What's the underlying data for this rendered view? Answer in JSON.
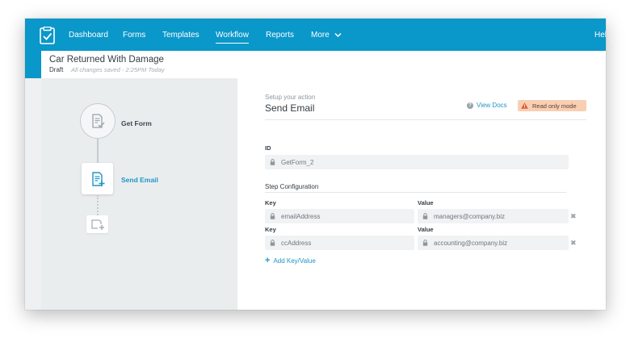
{
  "nav": {
    "items": [
      {
        "label": "Dashboard",
        "active": false
      },
      {
        "label": "Forms",
        "active": false
      },
      {
        "label": "Templates",
        "active": false
      },
      {
        "label": "Workflow",
        "active": true
      },
      {
        "label": "Reports",
        "active": false
      },
      {
        "label": "More",
        "active": false
      }
    ],
    "user_label": "Hel",
    "icons": {
      "logo": "clipboard-check-icon",
      "more": "chevron-down-icon"
    }
  },
  "document": {
    "title": "Car Returned With Damage",
    "status": "Draft",
    "saved_text": "All changes saved - 2:25PM Today"
  },
  "workflow": {
    "steps": [
      {
        "label": "Get Form",
        "icon": "document-check-icon",
        "active": false
      },
      {
        "label": "Send Email",
        "icon": "document-add-icon",
        "active": true
      }
    ],
    "add_step_icon": "add-step-icon"
  },
  "action": {
    "setup_label": "Setup your action",
    "title": "Send Email",
    "view_docs": "View Docs",
    "read_only": "Read only mode",
    "id_label": "ID",
    "id_value": "GetForm_2",
    "config_label": "Step Configuration",
    "key_label": "Key",
    "value_label": "Value",
    "pairs": [
      {
        "key": "emailAddress",
        "value": "managers@company.biz"
      },
      {
        "key": "ccAddress",
        "value": "accounting@company.biz"
      }
    ],
    "remove_symbol": "✖",
    "add_key_value": "Add Key/Value",
    "add_symbol": "+"
  },
  "colors": {
    "brand": "#0a97c9",
    "link": "#1f95c7",
    "readonly_bg": "#f9cfb4"
  }
}
